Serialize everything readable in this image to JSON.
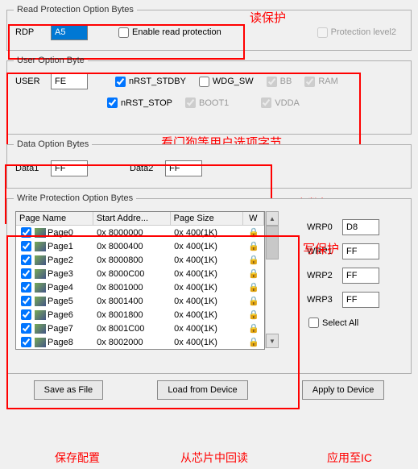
{
  "read_protection": {
    "legend": "Read Protection Option Bytes",
    "rdp_label": "RDP",
    "rdp_value": "A5",
    "enable_label": "Enable read protection",
    "level2_label": "Protection level2",
    "annotation": "读保护"
  },
  "user_option": {
    "legend": "User Option Byte",
    "user_label": "USER",
    "user_value": "FE",
    "nrst_stdby": "nRST_STDBY",
    "wdg_sw": "WDG_SW",
    "bb": "BB",
    "ram": "RAM",
    "nrst_stop": "nRST_STOP",
    "boot1": "BOOT1",
    "vdda": "VDDA",
    "annotation": "看门狗等用户选项字节"
  },
  "data_option": {
    "legend": "Data Option Bytes",
    "data1_label": "Data1",
    "data1_value": "FF",
    "data2_label": "Data2",
    "data2_value": "FF",
    "annotation": "用户数据"
  },
  "write_protection": {
    "legend": "Write Protection Option Bytes",
    "annotation": "写保护",
    "cols": {
      "c0": "Page Name",
      "c1": "Start Addre...",
      "c2": "Page Size",
      "c3": "W"
    },
    "rows": [
      {
        "name": "Page0",
        "addr": "0x 8000000",
        "size": "0x 400(1K)"
      },
      {
        "name": "Page1",
        "addr": "0x 8000400",
        "size": "0x 400(1K)"
      },
      {
        "name": "Page2",
        "addr": "0x 8000800",
        "size": "0x 400(1K)"
      },
      {
        "name": "Page3",
        "addr": "0x 8000C00",
        "size": "0x 400(1K)"
      },
      {
        "name": "Page4",
        "addr": "0x 8001000",
        "size": "0x 400(1K)"
      },
      {
        "name": "Page5",
        "addr": "0x 8001400",
        "size": "0x 400(1K)"
      },
      {
        "name": "Page6",
        "addr": "0x 8001800",
        "size": "0x 400(1K)"
      },
      {
        "name": "Page7",
        "addr": "0x 8001C00",
        "size": "0x 400(1K)"
      },
      {
        "name": "Page8",
        "addr": "0x 8002000",
        "size": "0x 400(1K)"
      }
    ],
    "wrp": [
      {
        "label": "WRP0",
        "value": "D8"
      },
      {
        "label": "WRP1",
        "value": "FF"
      },
      {
        "label": "WRP2",
        "value": "FF"
      },
      {
        "label": "WRP3",
        "value": "FF"
      }
    ],
    "select_all": "Select All"
  },
  "buttons": {
    "save": "Save as File",
    "load": "Load from Device",
    "apply": "Apply to Device",
    "save_ann": "保存配置",
    "load_ann": "从芯片中回读",
    "apply_ann": "应用至IC"
  }
}
